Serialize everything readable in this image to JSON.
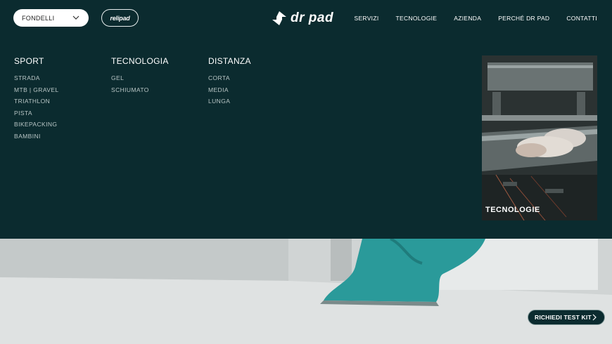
{
  "header": {
    "select": {
      "value": "FONDELLI"
    },
    "relipad_label": "relipad",
    "logo": {
      "name": "drpad-logo-icon",
      "text": "dr pad"
    },
    "nav": [
      "SERVIZI",
      "TECNOLOGIE",
      "AZIENDA",
      "PERCHÉ DR PAD",
      "CONTATTI"
    ]
  },
  "menu": {
    "columns": [
      {
        "title": "SPORT",
        "items": [
          "STRADA",
          "MTB | GRAVEL",
          "TRIATHLON",
          "PISTA",
          "BIKEPACKING",
          "BAMBINI"
        ]
      },
      {
        "title": "TECNOLOGIA",
        "items": [
          "GEL",
          "SCHIUMATO"
        ]
      },
      {
        "title": "DISTANZA",
        "items": [
          "CORTA",
          "MEDIA",
          "LUNGA"
        ]
      }
    ],
    "promo": {
      "label": "TECNOLOGIE"
    }
  },
  "cta": {
    "label": "RICHIEDI TEST KIT"
  },
  "colors": {
    "header_bg": "#0b2b2f",
    "accent_teal": "#2a9a9a",
    "text_muted": "#b9c6c6"
  }
}
